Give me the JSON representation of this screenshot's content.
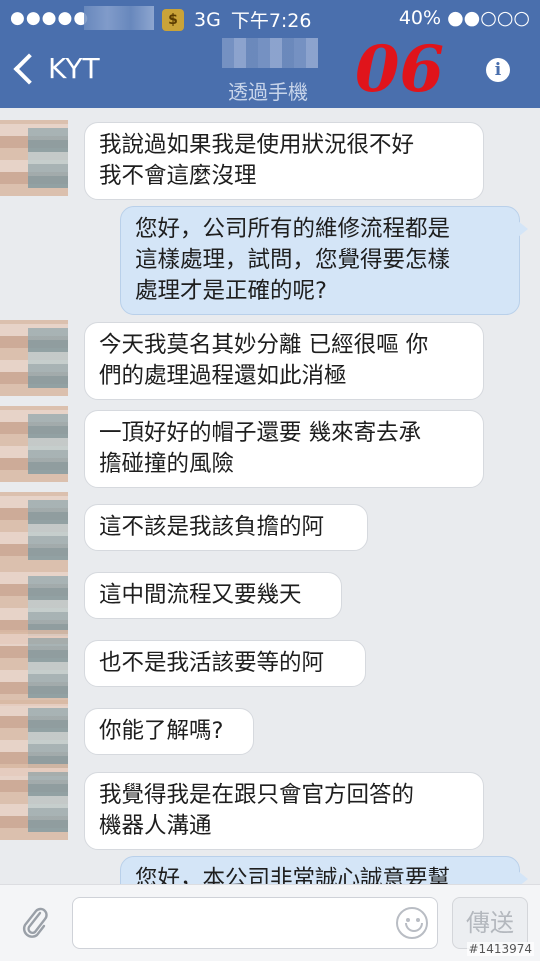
{
  "status_bar": {
    "signal": "●●●●●",
    "network": "3G",
    "time": "下午7:26",
    "battery_text": "40% ●●○○○"
  },
  "header": {
    "back_label": "KYT",
    "subtitle": "透過手機",
    "stamp": "06"
  },
  "messages": [
    {
      "side": "in",
      "text": "我說過如果我是使用狀況很不好\n我不會這麼沒理"
    },
    {
      "side": "out",
      "text": "您好，公司所有的維修流程都是\n這樣處理，試問，您覺得要怎樣\n處理才是正確的呢?"
    },
    {
      "side": "in",
      "text": "今天我莫名其妙分離 已經很嘔 你\n們的處理過程還如此消極"
    },
    {
      "side": "in",
      "text": "一頂好好的帽子還要 幾來寄去承\n擔碰撞的風險"
    },
    {
      "side": "in",
      "text": "這不該是我該負擔的阿"
    },
    {
      "side": "in",
      "text": "這中間流程又要幾天"
    },
    {
      "side": "in",
      "text": "也不是我活該要等的阿"
    },
    {
      "side": "in",
      "text": "你能了解嗎?"
    },
    {
      "side": "in",
      "text": "我覺得我是在跟只會官方回答的\n機器人溝通"
    },
    {
      "side": "out",
      "text": "您好，本公司非常誠心誠意要幫"
    }
  ],
  "input_bar": {
    "placeholder": "",
    "send_label": "傳送"
  },
  "watermark": "#1413974",
  "colors": {
    "header_bg": "#4a6fad",
    "incoming_bubble": "#ffffff",
    "outgoing_bubble": "#d4e5f7",
    "stamp": "#e0141b"
  }
}
